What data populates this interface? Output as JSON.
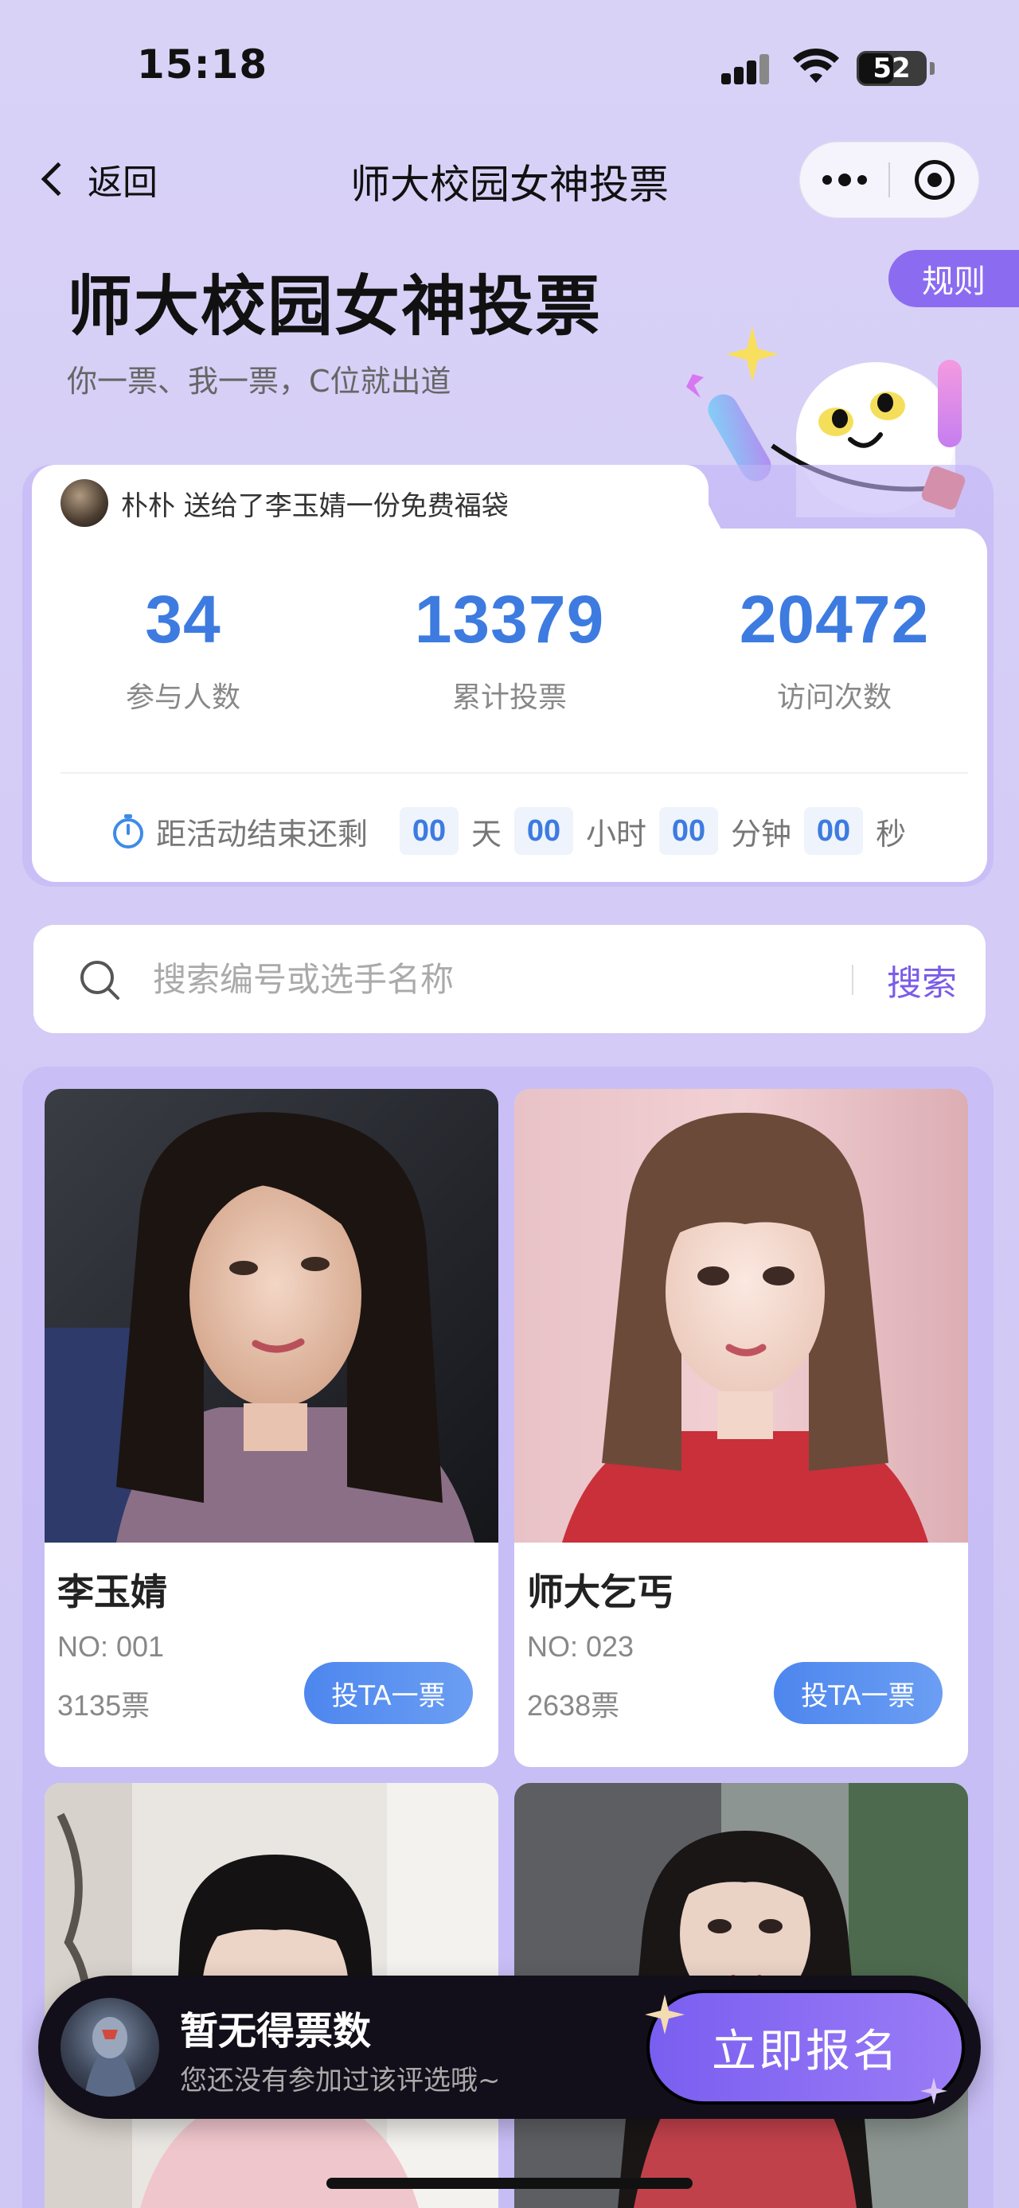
{
  "status": {
    "time": "15:18",
    "battery": "52"
  },
  "nav": {
    "back_label": "返回",
    "title": "师大校园女神投票"
  },
  "header": {
    "rules_label": "规则",
    "title": "师大校园女神投票",
    "subtitle": "你一票、我一票，C位就出道"
  },
  "ticker": {
    "text": "朴朴 送给了李玉婧一份免费福袋"
  },
  "stats": [
    {
      "value": "34",
      "label": "参与人数"
    },
    {
      "value": "13379",
      "label": "累计投票"
    },
    {
      "value": "20472",
      "label": "访问次数"
    }
  ],
  "countdown": {
    "label": "距活动结束还剩",
    "days": "00",
    "days_unit": "天",
    "hours": "00",
    "hours_unit": "小时",
    "minutes": "00",
    "minutes_unit": "分钟",
    "seconds": "00",
    "seconds_unit": "秒"
  },
  "search": {
    "placeholder": "搜索编号或选手名称",
    "button_label": "搜索"
  },
  "contestants": [
    {
      "name": "李玉婧",
      "no": "NO: 001",
      "votes": "3135票",
      "vote_label": "投TA一票"
    },
    {
      "name": "师大乞丐",
      "no": "NO: 023",
      "votes": "2638票",
      "vote_label": "投TA一票"
    }
  ],
  "bottom": {
    "title": "暂无得票数",
    "subtitle": "您还没有参加过该评选哦~",
    "signup_label": "立即报名"
  },
  "colors": {
    "accent": "#8b6cf0",
    "stat_blue": "#3d7be0",
    "background": "#d9d2f7"
  }
}
